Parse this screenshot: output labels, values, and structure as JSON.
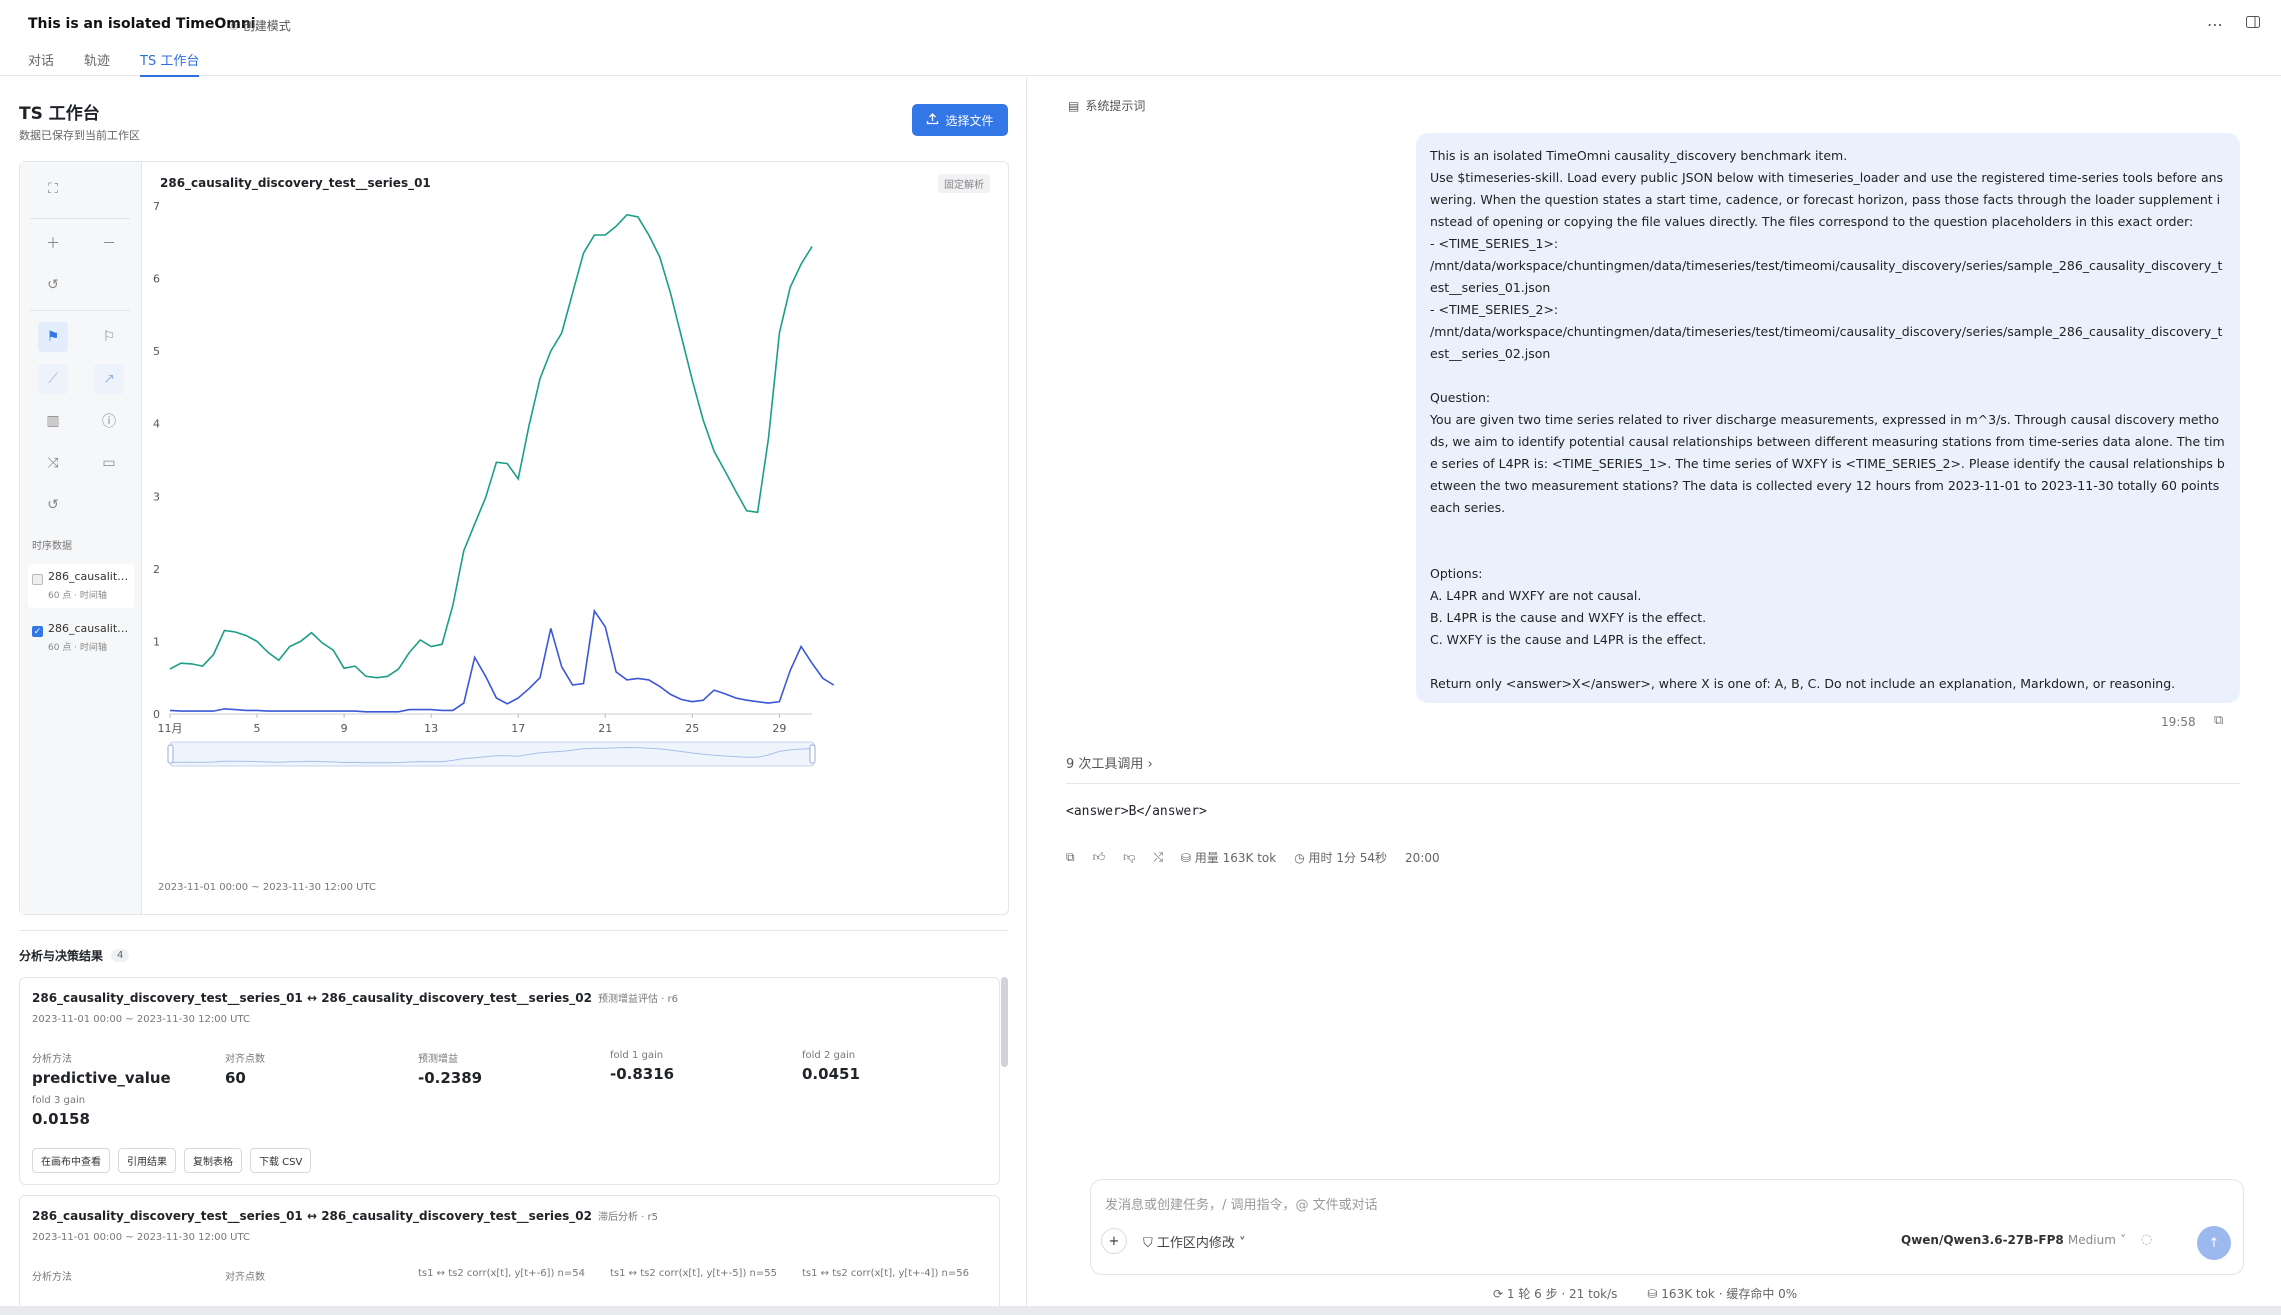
{
  "header": {
    "title": "This is an isolated TimeOmni",
    "mode": "创建模式",
    "tabs": [
      "对话",
      "轨迹",
      "TS 工作台"
    ]
  },
  "workbench": {
    "title": "TS 工作台",
    "subtitle": "数据已保存到当前工作区",
    "select_file": "选择文件",
    "series_section_label": "时序数据",
    "series": [
      {
        "name": "286_causality...",
        "meta": "60 点 · 时间轴",
        "checked": false
      },
      {
        "name": "286_causality...",
        "meta": "60 点 · 时间轴",
        "checked": true
      }
    ],
    "chart_title": "286_causality_discovery_test__series_01",
    "fixed_tag": "固定解析",
    "range": "2023-11-01 00:00 ~ 2023-11-30 12:00 UTC"
  },
  "chart_data": {
    "type": "line",
    "x_tick_labels": [
      "11月",
      "5",
      "9",
      "13",
      "17",
      "21",
      "25",
      "29"
    ],
    "ylim": [
      0,
      7
    ],
    "y_ticks": [
      "0",
      "1",
      "2",
      "3",
      "4",
      "5",
      "6",
      "7"
    ],
    "series": [
      {
        "color": "#1a9f86",
        "values": [
          0.62,
          0.7,
          0.69,
          0.66,
          0.82,
          1.15,
          1.13,
          1.08,
          1.0,
          0.85,
          0.74,
          0.93,
          1.0,
          1.12,
          0.98,
          0.88,
          0.63,
          0.66,
          0.52,
          0.5,
          0.52,
          0.62,
          0.85,
          1.02,
          0.93,
          0.96,
          1.5,
          2.25,
          2.62,
          2.98,
          3.47,
          3.45,
          3.24,
          3.98,
          4.62,
          5.0,
          5.25,
          5.8,
          6.35,
          6.6,
          6.6,
          6.72,
          6.88,
          6.85,
          6.6,
          6.3,
          5.8,
          5.2,
          4.6,
          4.05,
          3.62,
          3.35,
          3.07,
          2.8,
          2.78,
          3.8,
          5.25,
          5.88,
          6.2,
          6.44
        ]
      },
      {
        "color": "#3a57d6",
        "values": [
          0.05,
          0.04,
          0.04,
          0.04,
          0.04,
          0.07,
          0.06,
          0.05,
          0.05,
          0.04,
          0.04,
          0.04,
          0.04,
          0.04,
          0.04,
          0.04,
          0.04,
          0.04,
          0.03,
          0.03,
          0.03,
          0.03,
          0.06,
          0.06,
          0.06,
          0.05,
          0.05,
          0.15,
          0.78,
          0.52,
          0.22,
          0.14,
          0.22,
          0.35,
          0.5,
          1.18,
          0.65,
          0.4,
          0.42,
          1.42,
          1.2,
          0.58,
          0.47,
          0.49,
          0.47,
          0.38,
          0.27,
          0.2,
          0.17,
          0.19,
          0.33,
          0.28,
          0.22,
          0.19,
          0.17,
          0.15,
          0.17,
          0.6,
          0.93,
          0.7,
          0.49,
          0.4
        ]
      }
    ]
  },
  "results": {
    "title": "分析与决策结果",
    "count": "4",
    "cards": [
      {
        "title": "286_causality_discovery_test__series_01 ↔ 286_causality_discovery_test__series_02",
        "kind": "预测增益评估 · r6",
        "range": "2023-11-01 00:00 ~ 2023-11-30 12:00 UTC",
        "metrics": [
          {
            "label": "分析方法",
            "value": "predictive_value"
          },
          {
            "label": "对齐点数",
            "value": "60"
          },
          {
            "label": "预测增益",
            "value": "-0.2389"
          },
          {
            "label": "fold 1 gain",
            "value": "-0.8316"
          },
          {
            "label": "fold 2 gain",
            "value": "0.0451"
          },
          {
            "label": "fold 3 gain",
            "value": "0.0158"
          }
        ],
        "actions": [
          "在画布中查看",
          "引用结果",
          "复制表格",
          "下载 CSV"
        ]
      },
      {
        "title": "286_causality_discovery_test__series_01 ↔ 286_causality_discovery_test__series_02",
        "kind": "滞后分析 · r5",
        "range": "2023-11-01 00:00 ~ 2023-11-30 12:00 UTC",
        "metrics": [
          {
            "label": "分析方法"
          },
          {
            "label": "对齐点数"
          },
          {
            "label": "ts1 ↔ ts2 corr(x[t], y[t+-6]) n=54"
          },
          {
            "label": "ts1 ↔ ts2 corr(x[t], y[t+-5]) n=55"
          },
          {
            "label": "ts1 ↔ ts2 corr(x[t], y[t+-4]) n=56"
          }
        ]
      }
    ]
  },
  "chat": {
    "system_prompt_label": "系统提示词",
    "user_message": "This is an isolated TimeOmni causality_discovery benchmark item.\nUse $timeseries-skill. Load every public JSON below with timeseries_loader and use the registered time-series tools before answering. When the question states a start time, cadence, or forecast horizon, pass those facts through the loader supplement instead of opening or copying the file values directly. The files correspond to the question placeholders in this exact order:\n- <TIME_SERIES_1>:\n/mnt/data/workspace/chuntingmen/data/timeseries/test/timeomi/causality_discovery/series/sample_286_causality_discovery_test__series_01.json\n- <TIME_SERIES_2>:\n/mnt/data/workspace/chuntingmen/data/timeseries/test/timeomi/causality_discovery/series/sample_286_causality_discovery_test__series_02.json\n\nQuestion:\nYou are given two time series related to river discharge measurements, expressed in m^3/s. Through causal discovery methods, we aim to identify potential causal relationships between different measuring stations from time-series data alone. The time series of L4PR is: <TIME_SERIES_1>. The time series of WXFY is <TIME_SERIES_2>. Please identify the causal relationships between the two measurement stations? The data is collected every 12 hours from 2023-11-01 to 2023-11-30 totally 60 points each series.\n\n\nOptions:\nA. L4PR and WXFY are not causal.\nB. L4PR is the cause and WXFY is the effect.\nC. WXFY is the cause and L4PR is the effect.\n\nReturn only <answer>X</answer>, where X is one of: A, B, C. Do not include an explanation, Markdown, or reasoning.",
    "message_time": "19:58",
    "tool_calls": "9 次工具调用",
    "answer": "<answer>B</answer>",
    "usage": "用量 163K tok",
    "elapsed": "用时 1分 54秒",
    "answer_time": "20:00"
  },
  "composer": {
    "placeholder": "发消息或创建任务，/ 调用指令，@ 文件或对话",
    "workspace_edit": "工作区内修改",
    "model": "Qwen/Qwen3.6-27B-FP8",
    "effort": "Medium"
  },
  "status": {
    "turns": "1 轮 6 步 · 21 tok/s",
    "tokens": "163K tok · 缓存命中 0%"
  }
}
